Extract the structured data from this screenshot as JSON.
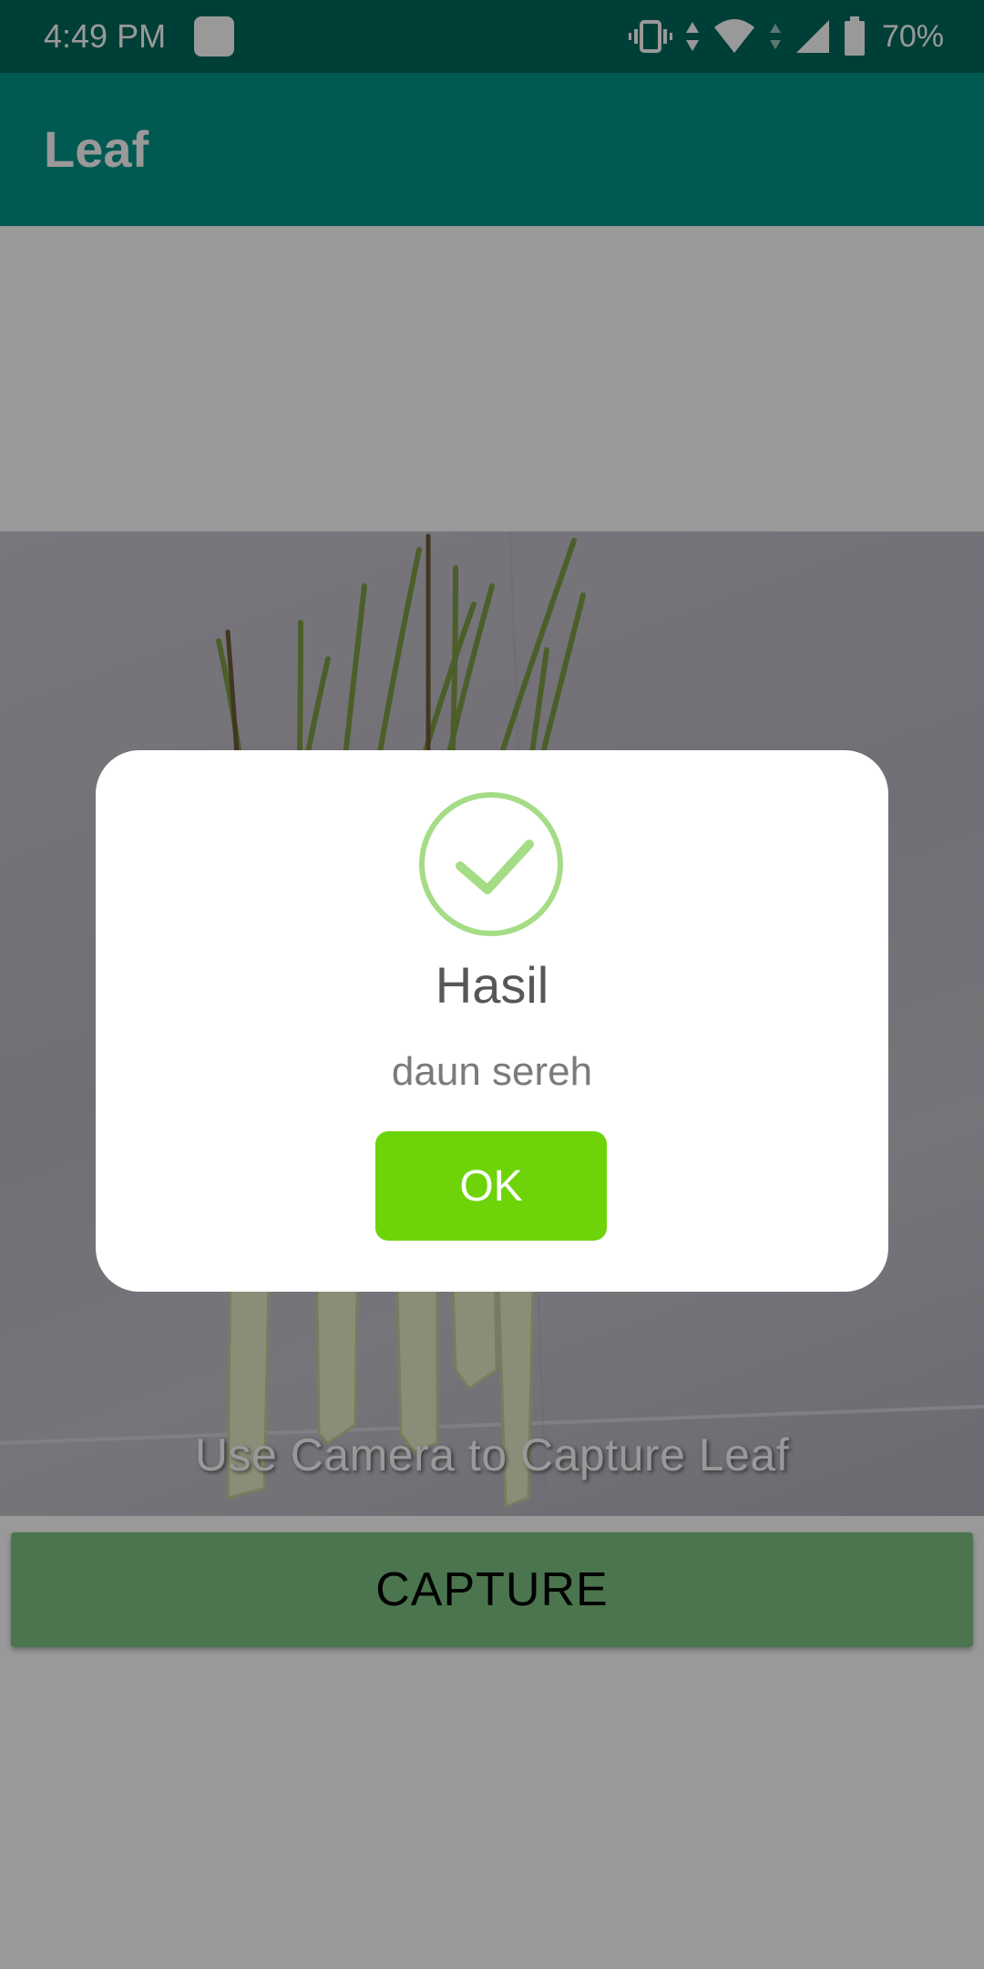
{
  "status_bar": {
    "time": "4:49 PM",
    "battery_percent": "70%",
    "icons": [
      "app-notification-icon",
      "vibrate-icon",
      "data-arrows-icon",
      "wifi-icon",
      "cell-signal-icon",
      "battery-icon"
    ]
  },
  "app_bar": {
    "title": "Leaf"
  },
  "camera": {
    "hint": "Use Camera to Capture Leaf"
  },
  "capture_button": {
    "label": "CAPTURE"
  },
  "dialog": {
    "icon": "checkmark-circle-icon",
    "title": "Hasil",
    "message": "daun sereh",
    "ok_label": "OK"
  },
  "colors": {
    "status_bar": "#00695c",
    "app_bar": "#009688",
    "capture_button": "#7dc383",
    "ok_button": "#6ed409",
    "success_icon": "#a5dc86"
  }
}
